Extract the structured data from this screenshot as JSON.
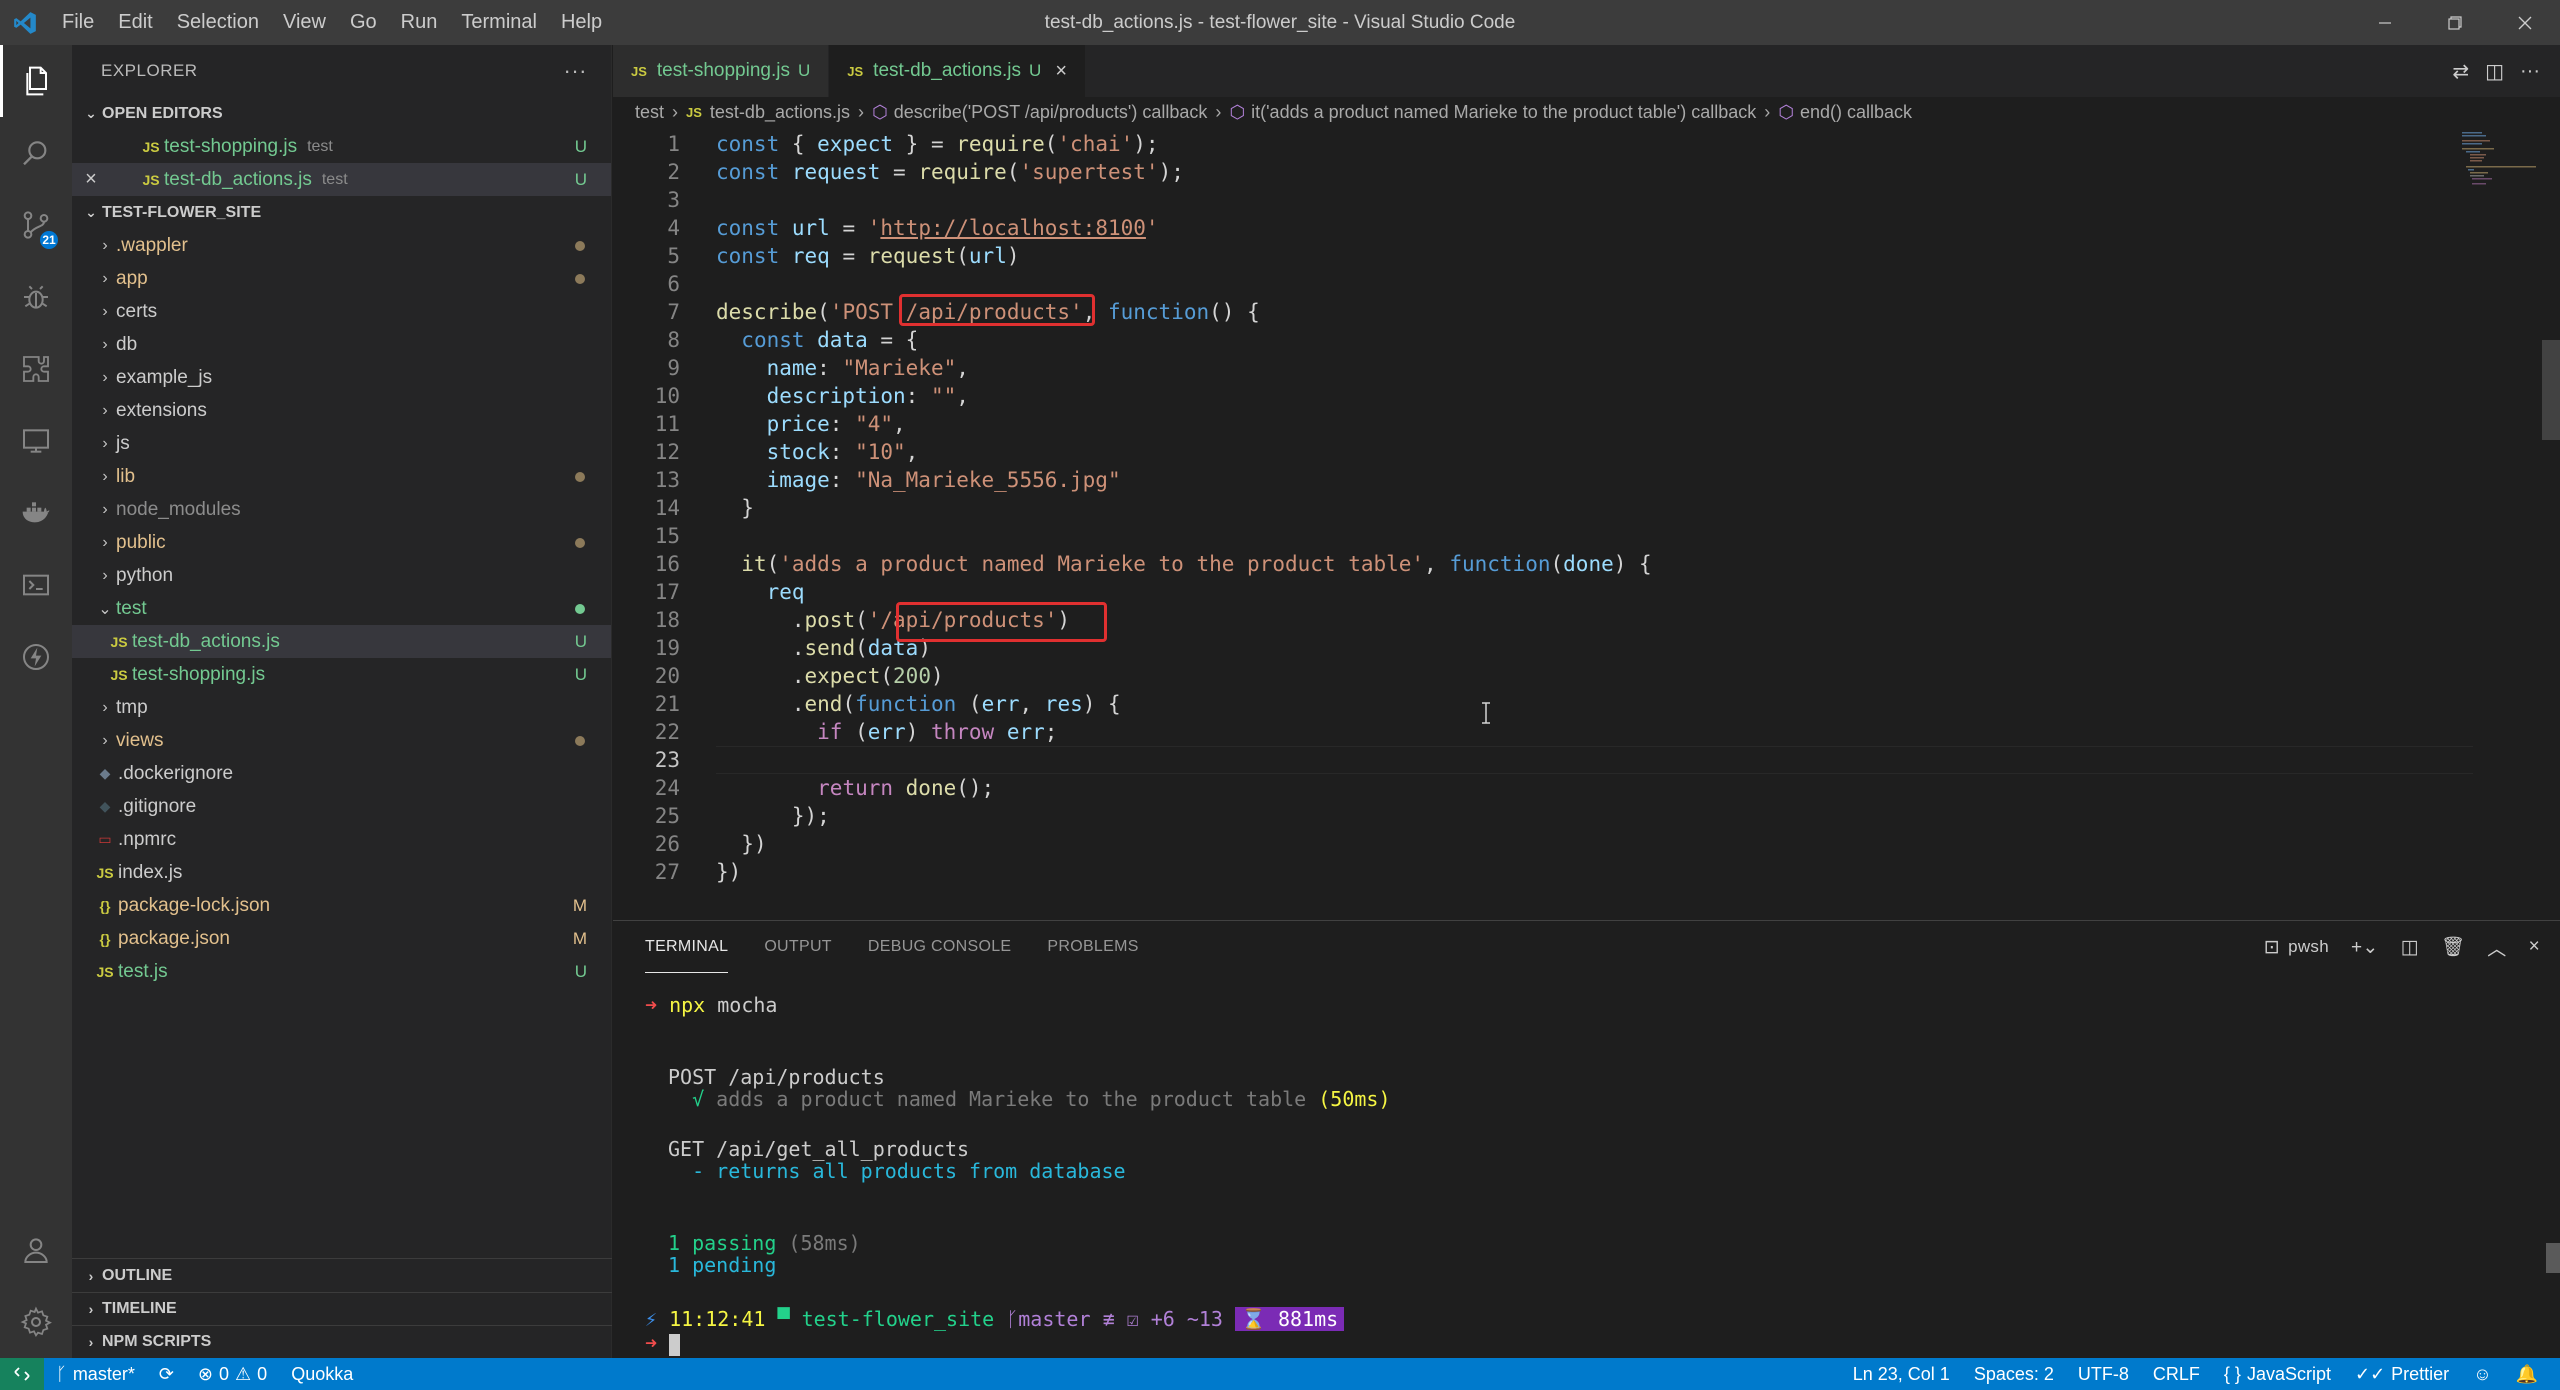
{
  "window": {
    "title": "test-db_actions.js - test-flower_site - Visual Studio Code",
    "menu": [
      "File",
      "Edit",
      "Selection",
      "View",
      "Go",
      "Run",
      "Terminal",
      "Help"
    ]
  },
  "activity": {
    "source_control_badge": "21"
  },
  "sidebar": {
    "title": "EXPLORER",
    "more": "···",
    "open_editors": {
      "header": "OPEN EDITORS",
      "items": [
        {
          "icon": "JS",
          "name": "test-shopping.js",
          "desc": "test",
          "status": "U"
        },
        {
          "icon": "JS",
          "name": "test-db_actions.js",
          "desc": "test",
          "status": "U"
        }
      ]
    },
    "project": {
      "header": "TEST-FLOWER_SITE",
      "items": [
        {
          "name": ".wappler"
        },
        {
          "name": "app"
        },
        {
          "name": "certs"
        },
        {
          "name": "db"
        },
        {
          "name": "example_js"
        },
        {
          "name": "extensions"
        },
        {
          "name": "js"
        },
        {
          "name": "lib"
        },
        {
          "name": "node_modules"
        },
        {
          "name": "public"
        },
        {
          "name": "python"
        },
        {
          "name": "test"
        },
        {
          "name": "test-db_actions.js",
          "status": "U"
        },
        {
          "name": "test-shopping.js",
          "status": "U"
        },
        {
          "name": "tmp"
        },
        {
          "name": "views"
        },
        {
          "name": ".dockerignore"
        },
        {
          "name": ".gitignore"
        },
        {
          "name": ".npmrc"
        },
        {
          "name": "index.js"
        },
        {
          "name": "package-lock.json",
          "status": "M"
        },
        {
          "name": "package.json",
          "status": "M"
        },
        {
          "name": "test.js",
          "status": "U"
        }
      ]
    },
    "bottom_sections": [
      "OUTLINE",
      "TIMELINE",
      "NPM SCRIPTS"
    ]
  },
  "editor": {
    "tabs": [
      {
        "icon": "JS",
        "name": "test-shopping.js",
        "status": "U"
      },
      {
        "icon": "JS",
        "name": "test-db_actions.js",
        "status": "U"
      }
    ],
    "breadcrumb": {
      "folder": "test",
      "file": "test-db_actions.js",
      "sym1": "describe('POST /api/products') callback",
      "sym2": "it('adds a product named Marieke to the product table') callback",
      "sym3": "end() callback"
    },
    "line_numbers": [
      "1",
      "2",
      "3",
      "4",
      "5",
      "6",
      "7",
      "8",
      "9",
      "10",
      "11",
      "12",
      "13",
      "14",
      "15",
      "16",
      "17",
      "18",
      "19",
      "20",
      "21",
      "22",
      "23",
      "24",
      "25",
      "26",
      "27"
    ],
    "code": {
      "l1_kw": "const",
      "l1_a": " { ",
      "l1_var": "expect",
      "l1_b": " } = ",
      "l1_fn": "require",
      "l1_c": "(",
      "l1_str": "'chai'",
      "l1_d": ");",
      "l2_kw": "const",
      "l2_var": " request",
      "l2_a": " = ",
      "l2_fn": "require",
      "l2_c": "(",
      "l2_str": "'supertest'",
      "l2_d": ");",
      "l4_kw": "const",
      "l4_var": " url",
      "l4_a": " = ",
      "l4_q1": "'",
      "l4_url": "http://localhost:8100",
      "l4_q2": "'",
      "l5_kw": "const",
      "l5_var": " req",
      "l5_a": " = ",
      "l5_fn": "request",
      "l5_b": "(",
      "l5_arg": "url",
      "l5_c": ")",
      "l7_fn": "describe",
      "l7_a": "(",
      "l7_str1": "'POST ",
      "l7_str2": "/api/products'",
      "l7_b": ", ",
      "l7_kw": "function",
      "l7_c": "() {",
      "l8_kw": "const",
      "l8_var": " data",
      "l8_a": " = {",
      "l9_key": "name",
      "l9_a": ": ",
      "l9_str": "\"Marieke\"",
      "l9_b": ",",
      "l10_key": "description",
      "l10_a": ": ",
      "l10_str": "\"\"",
      "l10_b": ",",
      "l11_key": "price",
      "l11_a": ": ",
      "l11_str": "\"4\"",
      "l11_b": ",",
      "l12_key": "stock",
      "l12_a": ": ",
      "l12_str": "\"10\"",
      "l12_b": ",",
      "l13_key": "image",
      "l13_a": ": ",
      "l13_str": "\"Na_Marieke_5556.jpg\"",
      "l14": "}",
      "l16_fn": "it",
      "l16_a": "(",
      "l16_str": "'adds a product named Marieke to the product table'",
      "l16_b": ", ",
      "l16_kw": "function",
      "l16_c": "(",
      "l16_arg": "done",
      "l16_d": ") {",
      "l17_var": "req",
      "l18_a": ".",
      "l18_fn": "post",
      "l18_b": "(",
      "l18_str": "'/api/products'",
      "l18_c": ")",
      "l19_a": ".",
      "l19_fn": "send",
      "l19_b": "(",
      "l19_var": "data",
      "l19_c": ")",
      "l20_a": ".",
      "l20_fn": "expect",
      "l20_b": "(",
      "l20_num": "200",
      "l20_c": ")",
      "l21_a": ".",
      "l21_fn": "end",
      "l21_b": "(",
      "l21_kw": "function",
      "l21_c": " (",
      "l21_v1": "err",
      "l21_d": ", ",
      "l21_v2": "res",
      "l21_e": ") {",
      "l22_ctl": "if",
      "l22_a": " (",
      "l22_var": "err",
      "l22_b": ") ",
      "l22_ctl2": "throw",
      "l22_var2": " err",
      "l22_c": ";",
      "l24_ctl": "return",
      "l24_fn": " done",
      "l24_a": "();",
      "l25": "});",
      "l26": "})",
      "l27": "})"
    }
  },
  "panel": {
    "tabs": [
      "TERMINAL",
      "OUTPUT",
      "DEBUG CONSOLE",
      "PROBLEMS"
    ],
    "shell": "pwsh",
    "terminal": {
      "prompt_arrow": "➜",
      "cmd1": "npx",
      "cmd2": " mocha",
      "suite1": "POST /api/products",
      "check": "√",
      "test1": " adds a product named Marieke to the product table",
      "time1": "(50ms)",
      "suite2": "GET /api/get_all_products",
      "pending_test": "- returns all products from database",
      "passing": "1 passing",
      "passing_time": " (58ms)",
      "pending": "1 pending",
      "time": "11:12:41",
      "folder_icon": "▀",
      "dir": "test-flower_site",
      "branch": "master",
      "git_status": "≢ ☑ +6 ~13",
      "duration": "⌛ 881ms"
    }
  },
  "statusbar": {
    "branch": "master*",
    "errors": "0",
    "warnings": "0",
    "quokka": "Quokka",
    "position": "Ln 23, Col 1",
    "spaces": "Spaces: 2",
    "encoding": "UTF-8",
    "eol": "CRLF",
    "language": "JavaScript",
    "prettier": "Prettier",
    "language_braces": "{ }"
  }
}
